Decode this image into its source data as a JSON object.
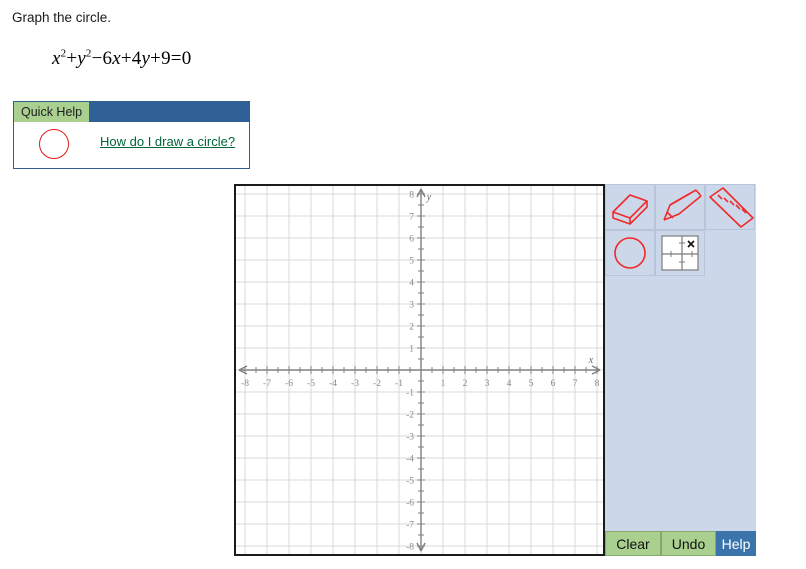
{
  "prompt": {
    "title": "Graph the circle.",
    "equation_plain": "x^2 + y^2 - 6x + 4y + 9 = 0",
    "equation_parts": {
      "x": "x",
      "exp1": "2",
      "plus1": "+",
      "y": "y",
      "exp2": "2",
      "minus": "−",
      "term_6x_num": "6",
      "term_6x_var": "x",
      "plus2": "+",
      "term_4y_num": "4",
      "term_4y_var": "y",
      "plus3": "+",
      "const": "9",
      "equals": "=",
      "rhs": "0"
    }
  },
  "quick_help": {
    "tab_label": "Quick Help",
    "icon_name": "red-circle-icon",
    "link_label": "How do I draw a circle?",
    "link_color": "#00663a",
    "tab_color": "#a9d08e",
    "bar_color": "#2f6096"
  },
  "graph": {
    "x_axis_label": "x",
    "y_axis_label": "y",
    "x_ticks": [
      "-8",
      "-7",
      "-6",
      "-5",
      "-4",
      "-3",
      "-2",
      "-1",
      "1",
      "2",
      "3",
      "4",
      "5",
      "6",
      "7",
      "8"
    ],
    "y_ticks": [
      "8",
      "7",
      "6",
      "5",
      "4",
      "3",
      "2",
      "1",
      "-1",
      "-2",
      "-3",
      "-4",
      "-5",
      "-6",
      "-7",
      "-8"
    ],
    "grid": true,
    "axis_color": "#808080",
    "grid_color": "#d9d9d9",
    "tick_label_color": "#888888",
    "border_color": "#1a1a1a"
  },
  "chart_data": {
    "type": "scatter",
    "title": "",
    "xlabel": "x",
    "ylabel": "y",
    "xlim": [
      -8.8,
      8.8
    ],
    "ylim": [
      -8.8,
      8.8
    ],
    "xticks": [
      -8,
      -7,
      -6,
      -5,
      -4,
      -3,
      -2,
      -1,
      1,
      2,
      3,
      4,
      5,
      6,
      7,
      8
    ],
    "yticks": [
      8,
      7,
      6,
      5,
      4,
      3,
      2,
      1,
      -1,
      -2,
      -3,
      -4,
      -5,
      -6,
      -7,
      -8
    ],
    "minor_tick_step": 0.5,
    "grid": true,
    "legend": "none",
    "series": []
  },
  "tools": [
    {
      "id": "eraser",
      "icon_name": "eraser-icon",
      "label": "Eraser",
      "selected": false
    },
    {
      "id": "pencil",
      "icon_name": "pencil-icon",
      "label": "Pencil",
      "selected": false
    },
    {
      "id": "ruler",
      "icon_name": "ruler-icon",
      "label": "Ruler/Line",
      "selected": false
    },
    {
      "id": "circle",
      "icon_name": "circle-tool-icon",
      "label": "Circle",
      "selected": false
    },
    {
      "id": "point",
      "icon_name": "graph-point-icon",
      "label": "Plot point",
      "selected": false
    }
  ],
  "buttons": {
    "clear": "Clear",
    "undo": "Undo",
    "help": "Help",
    "green": "#a9d08e",
    "blue": "#3a74ab"
  }
}
